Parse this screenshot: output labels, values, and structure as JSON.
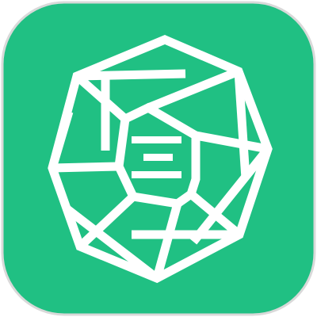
{
  "app_icon": {
    "icon_name": "octagonal-aperture-logo-icon",
    "background_color": "#20c083",
    "border_color": "#d9d9d9",
    "line_color": "#ffffff"
  }
}
